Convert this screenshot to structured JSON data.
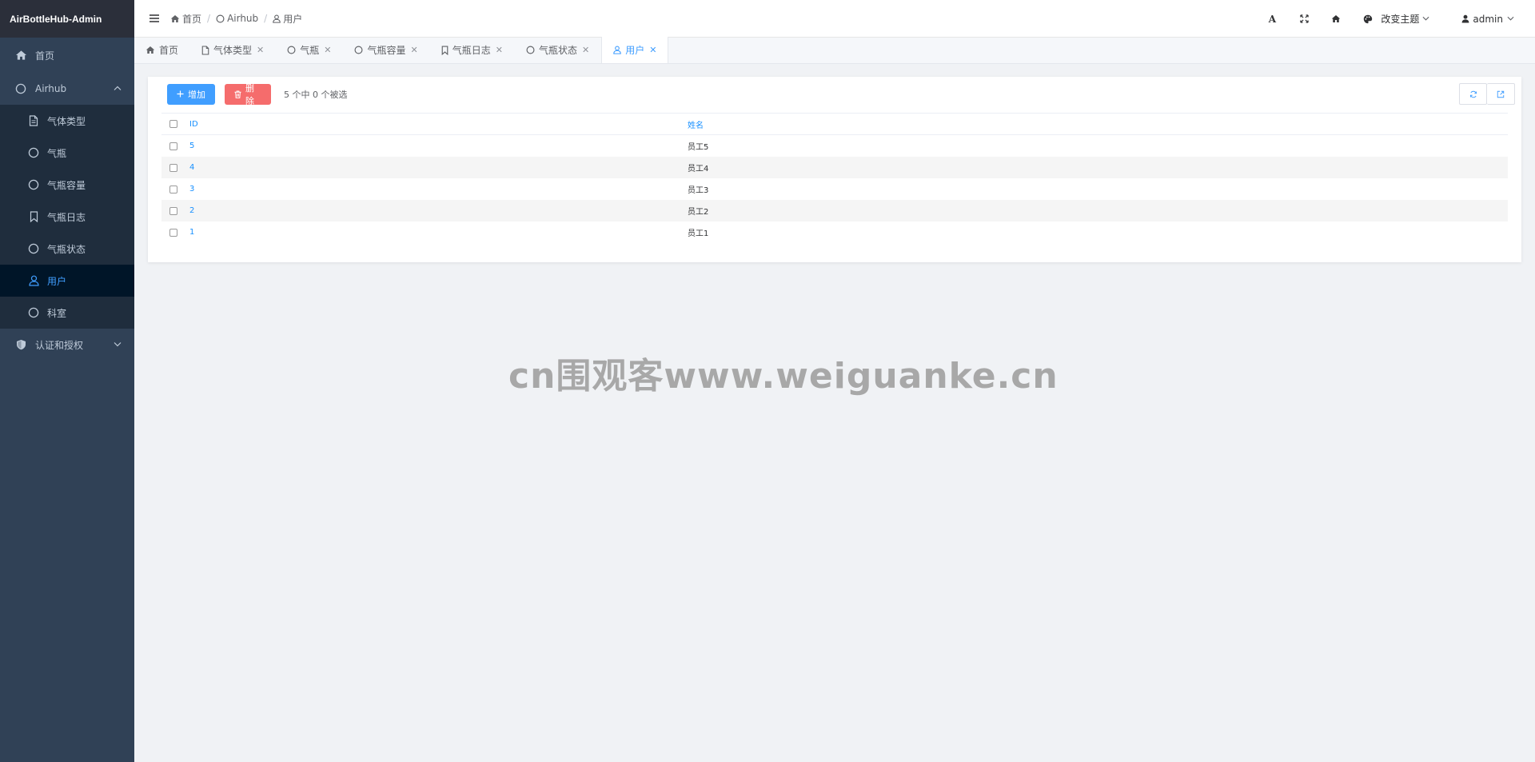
{
  "app": {
    "title": "AirBottleHub-Admin"
  },
  "sidebar": {
    "items": [
      {
        "label": "首页",
        "icon": "home-icon",
        "level": 1
      },
      {
        "label": "Airhub",
        "icon": "circle-icon",
        "level": 1,
        "expanded": true
      },
      {
        "label": "气体类型",
        "icon": "document-icon",
        "level": 2
      },
      {
        "label": "气瓶",
        "icon": "circle-icon",
        "level": 2
      },
      {
        "label": "气瓶容量",
        "icon": "circle-icon",
        "level": 2
      },
      {
        "label": "气瓶日志",
        "icon": "bookmark-icon",
        "level": 2
      },
      {
        "label": "气瓶状态",
        "icon": "circle-icon",
        "level": 2
      },
      {
        "label": "用户",
        "icon": "user-icon",
        "level": 2,
        "active": true
      },
      {
        "label": "科室",
        "icon": "circle-icon",
        "level": 2
      },
      {
        "label": "认证和授权",
        "icon": "shield-icon",
        "level": 1,
        "expanded": false
      }
    ]
  },
  "header": {
    "breadcrumb": [
      {
        "label": "首页",
        "icon": "home-icon"
      },
      {
        "label": "Airhub",
        "icon": "circle-icon"
      },
      {
        "label": "用户",
        "icon": "user-icon"
      }
    ],
    "breadcrumb_sep": "/",
    "theme_label": "改变主题",
    "user_label": "admin",
    "font_icon_glyph": "A"
  },
  "tabs": [
    {
      "label": "首页",
      "icon": "home-icon",
      "closable": false
    },
    {
      "label": "气体类型",
      "icon": "document-icon",
      "closable": true
    },
    {
      "label": "气瓶",
      "icon": "circle-icon",
      "closable": true
    },
    {
      "label": "气瓶容量",
      "icon": "circle-icon",
      "closable": true
    },
    {
      "label": "气瓶日志",
      "icon": "bookmark-icon",
      "closable": true
    },
    {
      "label": "气瓶状态",
      "icon": "circle-icon",
      "closable": true
    },
    {
      "label": "用户",
      "icon": "user-icon",
      "closable": true,
      "active": true
    }
  ],
  "toolbar": {
    "add_label": "增加",
    "delete_label": "删除",
    "selection_info": "5 个中 0 个被选"
  },
  "table": {
    "columns": {
      "id": "ID",
      "name": "姓名"
    },
    "rows": [
      {
        "id": "5",
        "name": "员工5"
      },
      {
        "id": "4",
        "name": "员工4"
      },
      {
        "id": "3",
        "name": "员工3"
      },
      {
        "id": "2",
        "name": "员工2"
      },
      {
        "id": "1",
        "name": "员工1"
      }
    ]
  },
  "watermark": {
    "text": "cn围观客www.weiguanke.cn"
  },
  "colors": {
    "sidebar_bg": "#304156",
    "submenu_bg": "#1f2d3d",
    "active_menu_bg": "#001528",
    "accent": "#409eff",
    "danger": "#f56c6c"
  }
}
